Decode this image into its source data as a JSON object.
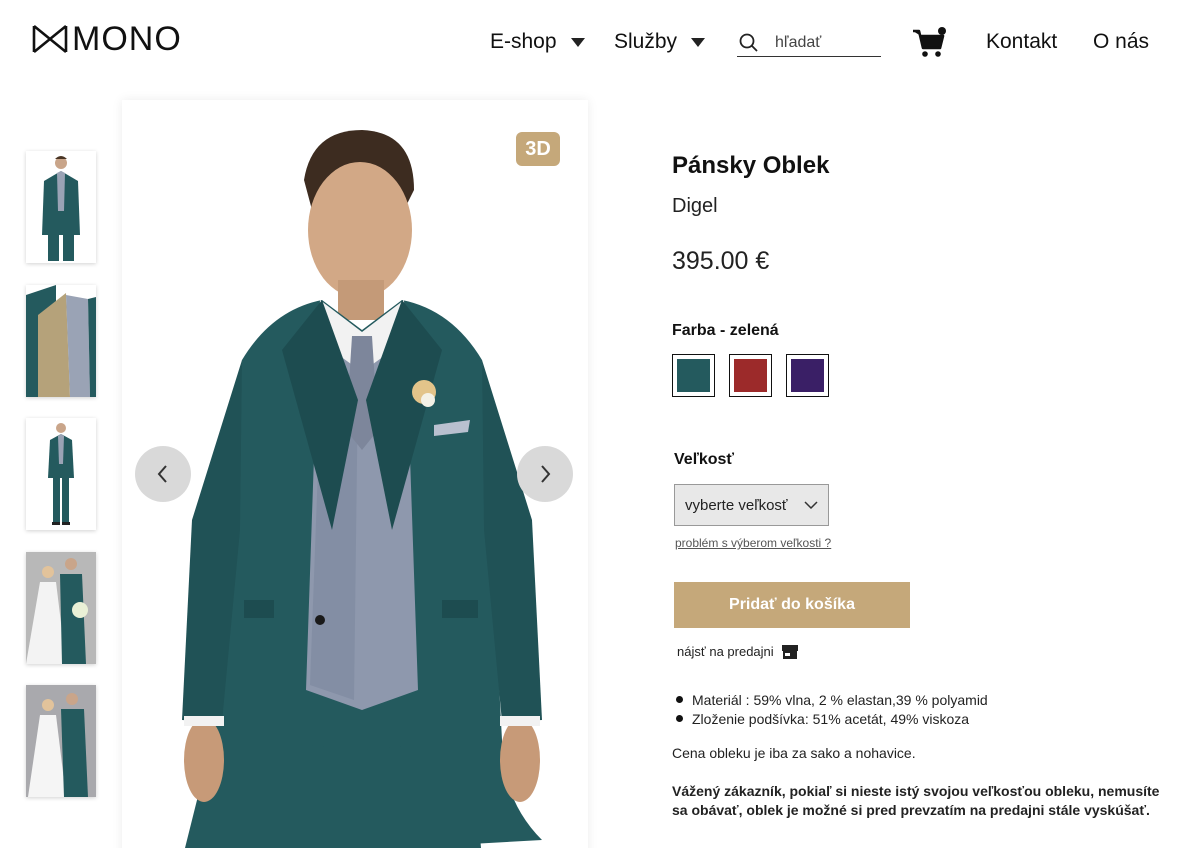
{
  "header": {
    "logo_text": "MONO",
    "nav": {
      "eshop_label": "E-shop",
      "sluzby_label": "Služby",
      "kontakt_label": "Kontakt",
      "onas_label": "O nás"
    },
    "search": {
      "placeholder": "hľadať"
    },
    "icons": [
      "search-icon",
      "cart-icon",
      "chevron-down-icon"
    ]
  },
  "gallery": {
    "badge_3d": "3D",
    "thumbnails": [
      {
        "name": "thumbnail-front"
      },
      {
        "name": "thumbnail-lining"
      },
      {
        "name": "thumbnail-full-length"
      },
      {
        "name": "thumbnail-couple-1"
      },
      {
        "name": "thumbnail-couple-2"
      }
    ],
    "icons": [
      "chevron-left-icon",
      "chevron-right-icon"
    ]
  },
  "product": {
    "title": "Pánsky Oblek",
    "brand": "Digel",
    "price": "395.00 €",
    "color_label": "Farba - zelená",
    "colors": [
      {
        "name": "zelená",
        "hex": "#245a5e"
      },
      {
        "name": "červená",
        "hex": "#9c2a2a"
      },
      {
        "name": "fialová",
        "hex": "#3a1f66"
      }
    ],
    "size_label": "Veľkosť",
    "size_select_value": "vyberte veľkosť",
    "size_help": "problém s výberom veľkosti ?",
    "add_to_cart": "Pridať do košíka",
    "store_link": "nájsť na predajni",
    "specs": [
      "Materiál : 59% vlna, 2 % elastan,39 % polyamid",
      "Zloženie podšívka: 51% acetát, 49% viskoza"
    ],
    "price_note": "Cena obleku je iba za sako a nohavice.",
    "customer_note": "Vážený zákazník, pokiaľ si nieste istý svojou veľkosťou obleku, nemusíte sa obávať, oblek je možné si pred prevzatím na predajni stále vyskúšať."
  },
  "colors": {
    "accent_gold": "#c5a87a",
    "suit_green": "#245a5e"
  }
}
